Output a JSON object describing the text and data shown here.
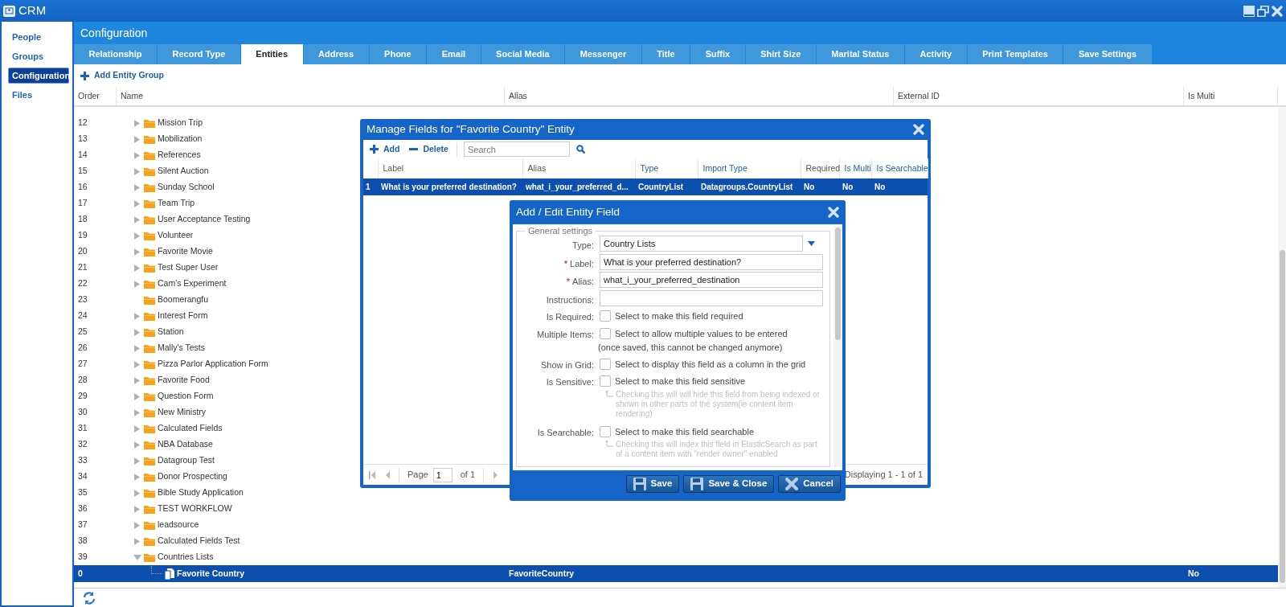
{
  "window": {
    "title": "CRM"
  },
  "sidebar": {
    "items": [
      {
        "label": "People",
        "selected": false
      },
      {
        "label": "Groups",
        "selected": false
      },
      {
        "label": "Configuration",
        "selected": true
      },
      {
        "label": "Files",
        "selected": false
      }
    ]
  },
  "page": {
    "title": "Configuration"
  },
  "tabs": [
    {
      "label": "Relationship",
      "selected": false
    },
    {
      "label": "Record Type",
      "selected": false
    },
    {
      "label": "Entities",
      "selected": true
    },
    {
      "label": "Address",
      "selected": false
    },
    {
      "label": "Phone",
      "selected": false
    },
    {
      "label": "Email",
      "selected": false
    },
    {
      "label": "Social Media",
      "selected": false
    },
    {
      "label": "Messenger",
      "selected": false
    },
    {
      "label": "Title",
      "selected": false
    },
    {
      "label": "Suffix",
      "selected": false
    },
    {
      "label": "Shirt Size",
      "selected": false
    },
    {
      "label": "Marital Status",
      "selected": false
    },
    {
      "label": "Activity",
      "selected": false
    },
    {
      "label": "Print Templates",
      "selected": false
    },
    {
      "label": "Save Settings",
      "selected": false
    }
  ],
  "toolbar": {
    "add_button": "Add Entity Group"
  },
  "grid": {
    "columns": [
      "Order",
      "Name",
      "Alias",
      "External ID",
      "Is Multi"
    ],
    "rows": [
      {
        "order": "12",
        "name": "Mission Trip",
        "kind": "group",
        "expanded": false,
        "selected": false
      },
      {
        "order": "13",
        "name": "Mobilization",
        "kind": "group",
        "expanded": false,
        "selected": false
      },
      {
        "order": "14",
        "name": "References",
        "kind": "group",
        "expanded": false,
        "selected": false
      },
      {
        "order": "15",
        "name": "Silent Auction",
        "kind": "group",
        "expanded": false,
        "selected": false
      },
      {
        "order": "16",
        "name": "Sunday School",
        "kind": "group",
        "expanded": false,
        "selected": false
      },
      {
        "order": "17",
        "name": "Team Trip",
        "kind": "group",
        "expanded": false,
        "selected": false
      },
      {
        "order": "18",
        "name": "User Acceptance Testing",
        "kind": "group",
        "expanded": false,
        "selected": false
      },
      {
        "order": "19",
        "name": "Volunteer",
        "kind": "group",
        "expanded": false,
        "selected": false
      },
      {
        "order": "20",
        "name": "Favorite Movie",
        "kind": "group",
        "expanded": false,
        "selected": false
      },
      {
        "order": "21",
        "name": "Test Super User",
        "kind": "group",
        "expanded": false,
        "selected": false
      },
      {
        "order": "22",
        "name": "Cam's Experiment",
        "kind": "group",
        "expanded": false,
        "selected": false
      },
      {
        "order": "23",
        "name": "Boomerangfu",
        "kind": "empty_group",
        "selected": false
      },
      {
        "order": "24",
        "name": "Interest Form",
        "kind": "group",
        "expanded": false,
        "selected": false
      },
      {
        "order": "25",
        "name": "Station",
        "kind": "group",
        "expanded": false,
        "selected": false
      },
      {
        "order": "26",
        "name": "Mally's Tests",
        "kind": "group",
        "expanded": false,
        "selected": false
      },
      {
        "order": "27",
        "name": "Pizza Parlor Application Form",
        "kind": "group",
        "expanded": false,
        "selected": false
      },
      {
        "order": "28",
        "name": "Favorite Food",
        "kind": "group",
        "expanded": false,
        "selected": false
      },
      {
        "order": "29",
        "name": "Question Form",
        "kind": "group",
        "expanded": false,
        "selected": false
      },
      {
        "order": "30",
        "name": "New Ministry",
        "kind": "group",
        "expanded": false,
        "selected": false
      },
      {
        "order": "31",
        "name": "Calculated Fields",
        "kind": "group",
        "expanded": false,
        "selected": false
      },
      {
        "order": "32",
        "name": "NBA Database",
        "kind": "group",
        "expanded": false,
        "selected": false
      },
      {
        "order": "33",
        "name": "Datagroup Test",
        "kind": "group",
        "expanded": false,
        "selected": false
      },
      {
        "order": "34",
        "name": "Donor Prospecting",
        "kind": "group",
        "expanded": false,
        "selected": false
      },
      {
        "order": "35",
        "name": "Bible Study Application",
        "kind": "group",
        "expanded": false,
        "selected": false
      },
      {
        "order": "36",
        "name": "TEST WORKFLOW",
        "kind": "group",
        "expanded": false,
        "selected": false
      },
      {
        "order": "37",
        "name": "leadsource",
        "kind": "group",
        "expanded": false,
        "selected": false
      },
      {
        "order": "38",
        "name": "Calculated Fields Test",
        "kind": "group",
        "expanded": false,
        "selected": false
      },
      {
        "order": "39",
        "name": "Countries Lists",
        "kind": "group",
        "expanded": true,
        "selected": false,
        "children": [
          {
            "order": "0",
            "name": "Favorite Country",
            "kind": "entity",
            "alias": "FavoriteCountry",
            "is_multi": "No",
            "selected": true
          }
        ]
      }
    ]
  },
  "manage_dialog": {
    "title": "Manage Fields for \"Favorite Country\" Entity",
    "add_button": "Add",
    "delete_button": "Delete",
    "search": {
      "placeholder": "Search"
    },
    "columns": [
      {
        "label": "Label",
        "sortable": false
      },
      {
        "label": "Alias",
        "sortable": false
      },
      {
        "label": "Type",
        "sortable": true
      },
      {
        "label": "Import Type",
        "sortable": true
      },
      {
        "label": "Required",
        "sortable": false
      },
      {
        "label": "Is Multi",
        "sortable": true
      },
      {
        "label": "Is Searchable",
        "sortable": true
      }
    ],
    "rows": [
      {
        "number": "1",
        "cells": [
          "What is your preferred destination?",
          "what_i_your_preferred_d...",
          "CountryList",
          "Datagroups.CountryList",
          "No",
          "No",
          "No"
        ],
        "selected": true
      }
    ],
    "paging": {
      "page_label": "Page",
      "page": "1",
      "of": "of 1",
      "display": "Displaying 1 - 1 of 1"
    }
  },
  "edit_dialog": {
    "title": "Add / Edit Entity Field",
    "section": "General settings",
    "fields": [
      {
        "kind": "select",
        "label": "Type:",
        "value": "Country Lists"
      },
      {
        "kind": "text",
        "label": "Label:",
        "required_mark": "*",
        "value": "What is your preferred destination?"
      },
      {
        "kind": "text",
        "label": "Alias:",
        "required_mark": "*",
        "value": "what_i_your_preferred_destination"
      },
      {
        "kind": "text",
        "label": "Instructions:"
      },
      {
        "kind": "checkbox",
        "label": "Is Required:",
        "text": "Select to make this field required",
        "checked": false
      },
      {
        "kind": "checkbox",
        "label": "Multiple Items:",
        "text": "Select to allow multiple values to be entered",
        "note": "(once saved, this cannot be changed anymore)",
        "checked": false
      },
      {
        "kind": "checkbox",
        "label": "Show in Grid:",
        "text": "Select to display this field as a column in the grid",
        "checked": false
      },
      {
        "kind": "checkbox",
        "label": "Is Sensitive:",
        "text": "Select to make this field sensitive",
        "hint": "Checking this will will hide this field from being indexed or shown in other parts of the system(ie content item rendering)",
        "checked": false
      },
      {
        "kind": "checkbox",
        "label": "Is Searchable:",
        "text": "Select to make this field searchable",
        "hint": "Checking this will index this field in ElasticSearch as part of a content item with \"render owner\" enabled",
        "checked": false
      }
    ],
    "buttons": [
      {
        "kind": "save",
        "label": "Save"
      },
      {
        "kind": "save",
        "label": "Save & Close"
      },
      {
        "kind": "cancel",
        "label": "Cancel"
      }
    ]
  }
}
